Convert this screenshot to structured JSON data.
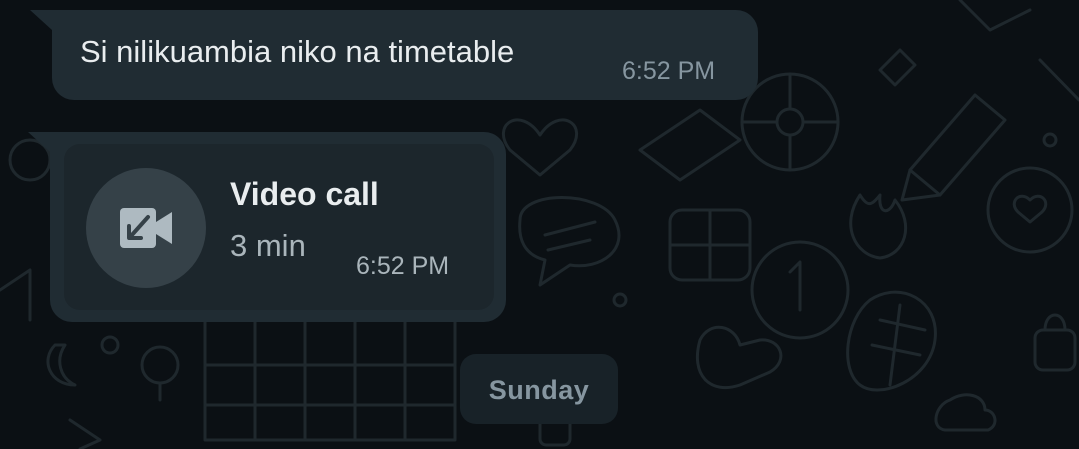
{
  "messages": [
    {
      "type": "text",
      "text": "Si nilikuambia niko na timetable",
      "time": "6:52 PM"
    },
    {
      "type": "call",
      "title": "Video call",
      "duration": "3 min",
      "time": "6:52 PM",
      "icon": "incoming-video-call-icon"
    }
  ],
  "date_divider": "Sunday",
  "colors": {
    "background": "#0b1014",
    "bubble": "#202c33",
    "primary_text": "#e9edef",
    "secondary_text": "#8696a0"
  }
}
